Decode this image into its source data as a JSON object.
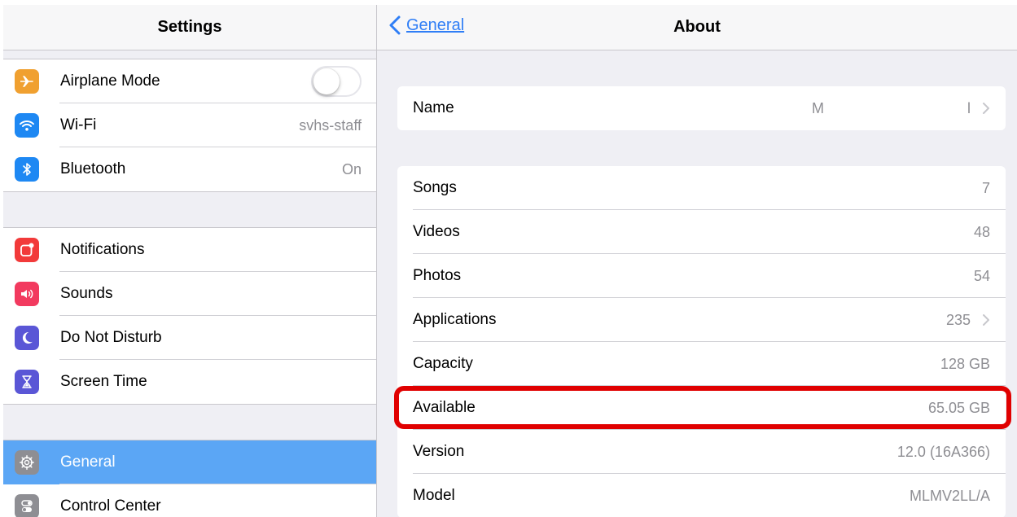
{
  "colors": {
    "accent": "#2f7ef6",
    "selected_row": "#5ba6f5",
    "highlight": "#e00000",
    "airplane_icon": "#f0a030",
    "wifi_icon": "#1e88f3",
    "bluetooth_icon": "#1e88f3",
    "notifications_icon": "#f23a3a",
    "sounds_icon": "#f23a5f",
    "dnd_icon": "#5a56d6",
    "screentime_icon": "#5a56d6",
    "general_icon": "#8e8e93",
    "controlcenter_icon": "#8e8e93"
  },
  "sidebar": {
    "title": "Settings",
    "group1": [
      {
        "label": "Airplane Mode",
        "icon": "airplane-icon",
        "toggle": "off"
      },
      {
        "label": "Wi-Fi",
        "value": "svhs-staff",
        "icon": "wifi-icon"
      },
      {
        "label": "Bluetooth",
        "value": "On",
        "icon": "bluetooth-icon"
      }
    ],
    "group2": [
      {
        "label": "Notifications",
        "icon": "notifications-icon"
      },
      {
        "label": "Sounds",
        "icon": "sounds-icon"
      },
      {
        "label": "Do Not Disturb",
        "icon": "moon-icon"
      },
      {
        "label": "Screen Time",
        "icon": "hourglass-icon"
      }
    ],
    "group3": [
      {
        "label": "General",
        "icon": "gear-icon",
        "selected": true
      },
      {
        "label": "Control Center",
        "icon": "toggles-icon"
      }
    ]
  },
  "detail": {
    "back_label": "General",
    "title": "About",
    "name_row": {
      "label": "Name",
      "value_start": "M",
      "value_end": "l"
    },
    "rows": [
      {
        "label": "Songs",
        "value": "7"
      },
      {
        "label": "Videos",
        "value": "48"
      },
      {
        "label": "Photos",
        "value": "54"
      },
      {
        "label": "Applications",
        "value": "235",
        "chevron": true
      },
      {
        "label": "Capacity",
        "value": "128 GB"
      },
      {
        "label": "Available",
        "value": "65.05 GB",
        "highlighted": true
      },
      {
        "label": "Version",
        "value": "12.0 (16A366)"
      },
      {
        "label": "Model",
        "value": "MLMV2LL/A"
      }
    ]
  }
}
